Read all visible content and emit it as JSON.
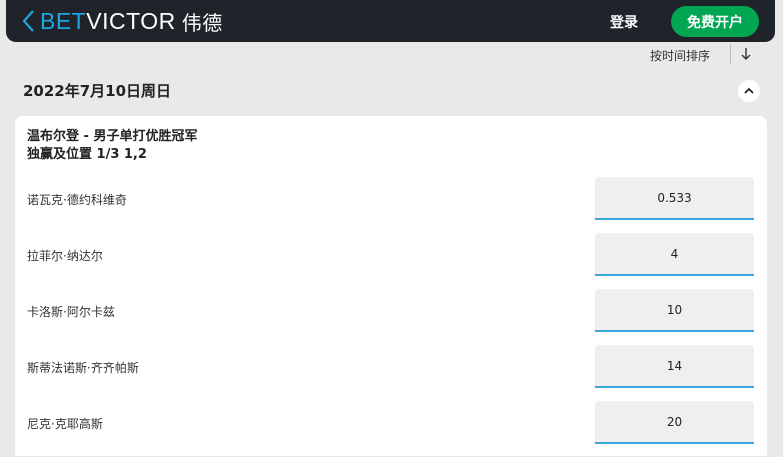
{
  "header": {
    "logo_bet": "BET",
    "logo_victor": "VICTOR",
    "logo_cn": "伟德",
    "login_label": "登录",
    "register_label": "免费开户"
  },
  "sort": {
    "label": "按时间排序"
  },
  "date_title": "2022年7月10日周日",
  "market": {
    "title": "温布尔登 - 男子单打优胜冠军",
    "subtitle": "独赢及位置 1/3 1,2",
    "runners": [
      {
        "name": "诺瓦克·德约科维奇",
        "odds": "0.533"
      },
      {
        "name": "拉菲尔·纳达尔",
        "odds": "4"
      },
      {
        "name": "卡洛斯·阿尔卡兹",
        "odds": "10"
      },
      {
        "name": "斯蒂法诺斯·齐齐帕斯",
        "odds": "14"
      },
      {
        "name": "尼克·克耶高斯",
        "odds": "20"
      }
    ]
  },
  "colors": {
    "header_bg": "#1f242a",
    "brand_blue": "#1ea7e1",
    "register_green": "#00a651",
    "odds_underline": "#3aa7dd"
  },
  "icons": {
    "back": "chevron-left-icon",
    "sort": "arrow-down-icon",
    "collapse": "chevron-up-icon"
  }
}
